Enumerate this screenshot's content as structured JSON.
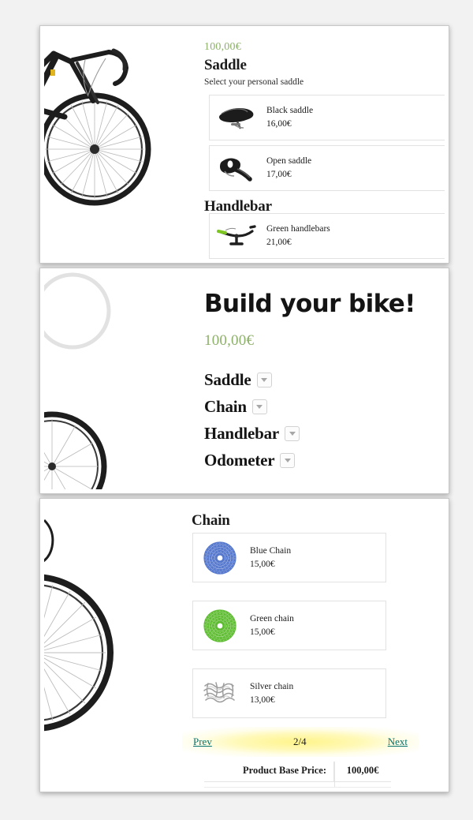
{
  "page": {
    "background_color": "#f2f2f2",
    "accent_green": "#8db06a",
    "link_teal": "#06736e",
    "highlight_yellow": "#fff48a"
  },
  "panel_top": {
    "price": "100,00€",
    "saddle_heading": "Saddle",
    "saddle_helper": "Select your personal saddle",
    "handlebar_heading": "Handlebar",
    "saddle_options": [
      {
        "name": "Black saddle",
        "price": "16,00€",
        "thumb": "black-saddle-image"
      },
      {
        "name": "Open saddle",
        "price": "17,00€",
        "thumb": "open-saddle-image"
      }
    ],
    "handlebar_options": [
      {
        "name": "Green handlebars",
        "price": "21,00€",
        "thumb": "green-handlebar-image"
      }
    ],
    "bike_image": "road-bike-front-wheel-image"
  },
  "panel_mid": {
    "title": "Build your bike!",
    "price": "100,00€",
    "accordion": [
      {
        "label": "Saddle",
        "caret": "chevron-down-icon"
      },
      {
        "label": "Chain",
        "caret": "chevron-down-icon"
      },
      {
        "label": "Handlebar",
        "caret": "chevron-down-icon"
      },
      {
        "label": "Odometer",
        "caret": "chevron-down-icon"
      }
    ],
    "bike_image": "road-bike-rear-wheel-image"
  },
  "panel_bot": {
    "chain_heading": "Chain",
    "chain_options": [
      {
        "name": "Blue Chain",
        "price": "15,00€",
        "thumb": "blue-chain-image"
      },
      {
        "name": "Green chain",
        "price": "15,00€",
        "thumb": "green-chain-image"
      },
      {
        "name": "Silver chain",
        "price": "13,00€",
        "thumb": "silver-chain-image"
      }
    ],
    "pager": {
      "prev": "Prev",
      "counter": "2/4",
      "next": "Next"
    },
    "base_price": {
      "label": "Product Base Price:",
      "value": "100,00€"
    },
    "bike_image": "road-bike-wheel-image"
  }
}
